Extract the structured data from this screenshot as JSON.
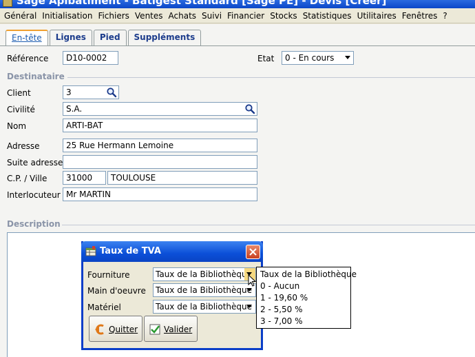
{
  "window": {
    "title": "Sage Apibatiment - Batigest Standard [Sage PE] - Devis [Créer]"
  },
  "menu": [
    "Général",
    "Initialisation",
    "Fichiers",
    "Ventes",
    "Achats",
    "Suivi",
    "Financier",
    "Stocks",
    "Statistiques",
    "Utilitaires",
    "Fenêtres",
    "?"
  ],
  "tabs": [
    "En-tête",
    "Lignes",
    "Pied",
    "Suppléments"
  ],
  "form": {
    "reference_label": "Référence",
    "reference_value": "D10-0002",
    "etat_label": "Etat",
    "etat_value": "0 - En cours",
    "destinataire_title": "Destinataire",
    "client_label": "Client",
    "client_value": "3",
    "civilite_label": "Civilité",
    "civilite_value": "S.A.",
    "nom_label": "Nom",
    "nom_value": "ARTI-BAT",
    "adresse_label": "Adresse",
    "adresse_value": "25 Rue Hermann Lemoine",
    "suite_adresse_label": "Suite adresse",
    "suite_adresse_value": "",
    "cp_ville_label": "C.P. / Ville",
    "cp_value": "31000",
    "ville_value": "TOULOUSE",
    "interlocuteur_label": "Interlocuteur",
    "interlocuteur_value": "Mr MARTIN",
    "description_title": "Description"
  },
  "dialog": {
    "title": "Taux de TVA",
    "fourniture_label": "Fourniture",
    "fourniture_value": "Taux de la Bibliothèque",
    "main_oeuvre_label": "Main d'oeuvre",
    "main_oeuvre_value": "Taux de la Bibliothèque",
    "materiel_label": "Matériel",
    "materiel_value": "Taux de la Bibliothèque",
    "quit_label": "Quitter",
    "validate_label": "Valider"
  },
  "dropdown_options": [
    "Taux de la Bibliothèque",
    "0 - Aucun",
    "1 - 19,60 %",
    "2 - 5,50 %",
    "3 - 7,00 %"
  ],
  "colors": {
    "title_blue": "#0a46c8",
    "section_gray": "#8a94a8",
    "tab_orange": "#f0a030",
    "dropdown_highlight": "#f5d880"
  }
}
